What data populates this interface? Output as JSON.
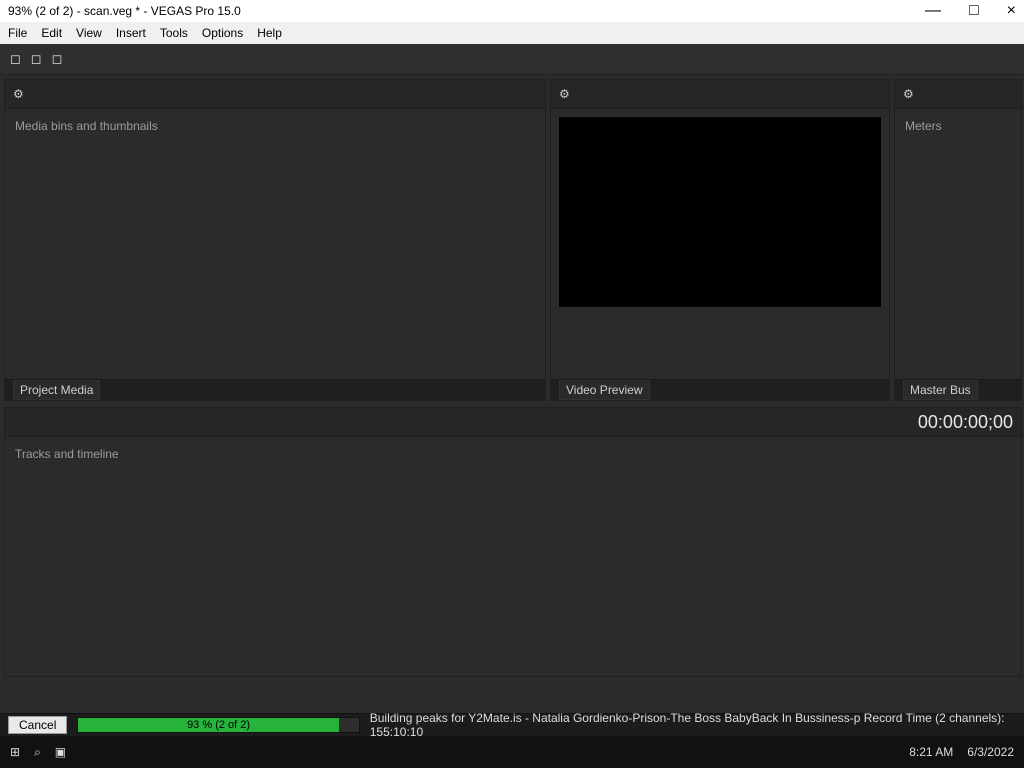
{
  "window": {
    "title": "93% (2 of 2) - scan.veg * - VEGAS Pro 15.0"
  },
  "menubar": [
    "File",
    "Edit",
    "View",
    "Insert",
    "Tools",
    "Options",
    "Help"
  ],
  "panels": {
    "project_media_title": "Project Media",
    "video_preview_title": "Video Preview",
    "master_bus_title": "Master Bus",
    "timeline_title": "00:00:00;00"
  },
  "status": {
    "cancel_label": "Cancel",
    "progress_label": "93 % (2 of 2)",
    "message": "Building peaks for Y2Mate.is - Natalia Gordienko-Prison-The Boss BabyBack In Bussiness-p Record Time (2 channels): 155:10:10"
  },
  "taskbar": {
    "time": "8:21 AM",
    "date": "6/3/2022"
  }
}
